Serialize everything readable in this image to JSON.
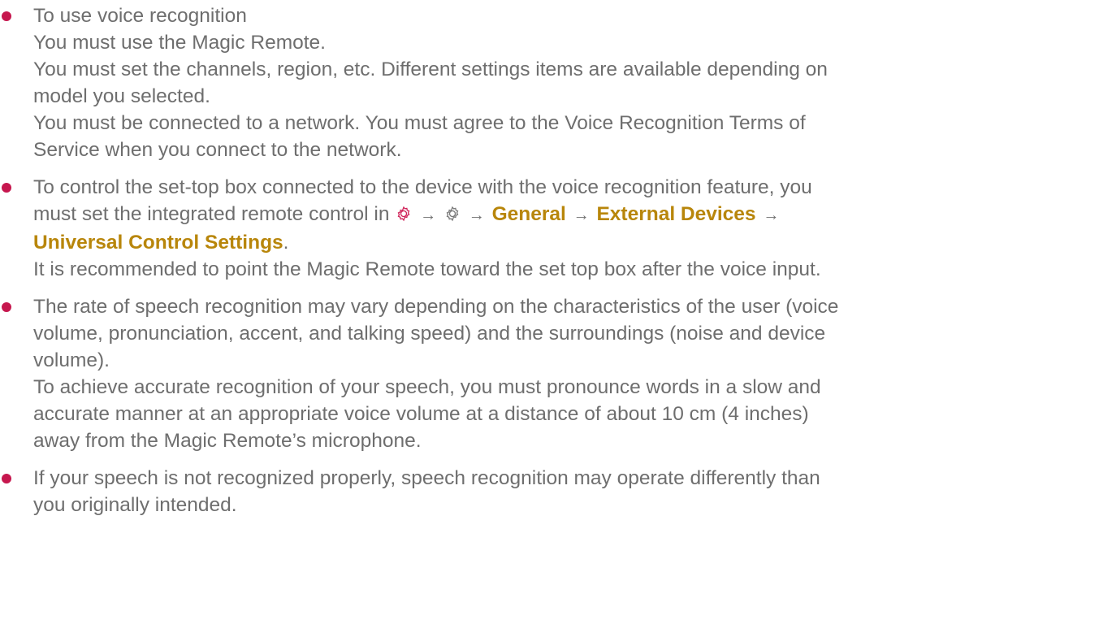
{
  "colors": {
    "bullet": "#c6174e",
    "text": "#6e6e6e",
    "highlight": "#b8860b",
    "gear_red": "#d0245a",
    "gear_grey": "#7a7a7a"
  },
  "items": [
    {
      "lines": [
        "To use voice recognition",
        "You must use the Magic Remote.",
        "You must set the channels, region, etc. Different settings items are available depending on",
        "model you selected.",
        "You must be connected to a network. You must agree to the Voice Recognition Terms of",
        "Service when you connect to the network."
      ]
    },
    {
      "line1": "To control the set-top box connected to the device with the voice recognition feature, you",
      "line2_prefix": "must set the integrated remote control in",
      "icon1": "settings-gear-icon",
      "icon2": "all-settings-gear-icon",
      "arrow": "→",
      "menu_general": "General",
      "menu_external": "External Devices",
      "menu_universal": "Universal Control Settings",
      "period": ".",
      "line4": "It is recommended to point the Magic Remote toward the set top box after the voice input."
    },
    {
      "lines": [
        "The rate of speech recognition may vary depending on the characteristics of the user (voice",
        "volume, pronunciation, accent, and talking speed) and the surroundings (noise and device",
        "volume).",
        "To achieve accurate recognition of your speech, you must pronounce words in a slow and",
        "accurate manner at an appropriate voice volume at a distance of about 10 cm (4 inches)",
        "away from the Magic Remote’s microphone."
      ]
    },
    {
      "lines": [
        "If your speech is not recognized properly, speech recognition may operate differently than",
        "you originally intended."
      ]
    }
  ]
}
